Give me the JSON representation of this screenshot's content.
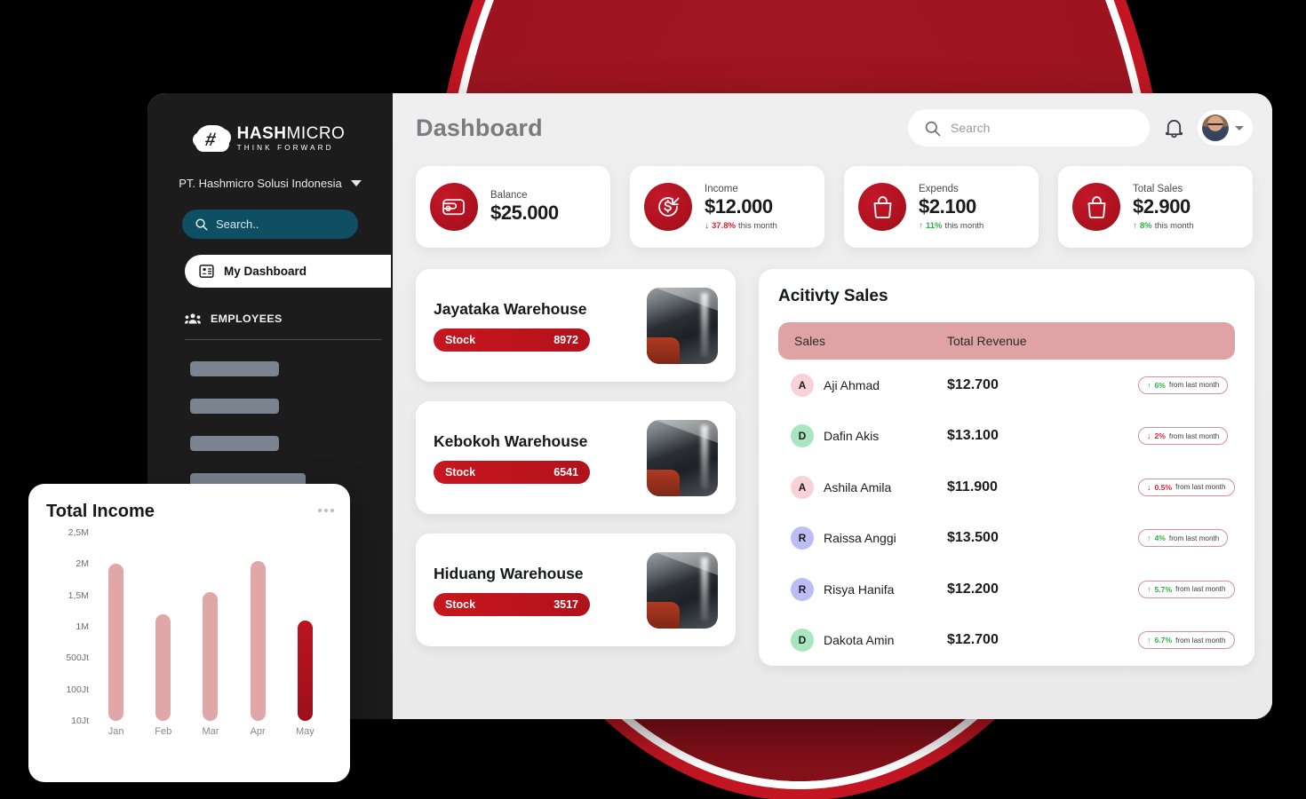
{
  "background": {
    "accent_red": "#a01620",
    "ring_white": "#ffffff",
    "page_bg": "#000000"
  },
  "sidebar": {
    "logo": {
      "name_bold": "HASH",
      "name_thin": "MICRO",
      "tagline": "THINK FORWARD",
      "icon": "hashmicro-cloud-logo"
    },
    "company": "PT. Hashmicro Solusi Indonesia",
    "search_placeholder": "Search..",
    "active_item": {
      "label": "My Dashboard",
      "icon": "dashboard-icon"
    },
    "section": {
      "label": "EMPLOYEES",
      "icon": "people-icon"
    },
    "skeleton_items": 4
  },
  "header": {
    "title": "Dashboard",
    "search_placeholder": "Search",
    "search_value": "",
    "notification_icon": "bell-icon",
    "avatar": "user-avatar",
    "chevron": "chevron-down-icon"
  },
  "stats": [
    {
      "label": "Balance",
      "value": "$25.000",
      "icon": "wallet-icon",
      "delta": null,
      "delta_dir": null,
      "delta_suffix": null
    },
    {
      "label": "Income",
      "value": "$12.000",
      "icon": "income-coin-icon",
      "delta": "37.8%",
      "delta_dir": "down",
      "delta_suffix": "this month"
    },
    {
      "label": "Expends",
      "value": "$2.100",
      "icon": "bag-icon",
      "delta": "11%",
      "delta_dir": "up",
      "delta_suffix": "this month"
    },
    {
      "label": "Total Sales",
      "value": "$2.900",
      "icon": "bag-icon",
      "delta": "8%",
      "delta_dir": "up",
      "delta_suffix": "this month"
    }
  ],
  "warehouses": [
    {
      "name": "Jayataka Warehouse",
      "stock_label": "Stock",
      "stock_value": "8972",
      "thumb": "warehouse-photo"
    },
    {
      "name": "Kebokoh Warehouse",
      "stock_label": "Stock",
      "stock_value": "6541",
      "thumb": "warehouse-photo"
    },
    {
      "name": "Hiduang Warehouse",
      "stock_label": "Stock",
      "stock_value": "3517",
      "thumb": "warehouse-photo"
    }
  ],
  "sales": {
    "title": "Acitivty Sales",
    "columns": {
      "name": "Sales",
      "revenue": "Total Revenue"
    },
    "badge_suffix": "from last month",
    "rows": [
      {
        "initial": "A",
        "avatar_color": "#f8d2d6",
        "name": "Aji Ahmad",
        "revenue": "$12.700",
        "delta": "6%",
        "dir": "up"
      },
      {
        "initial": "D",
        "avatar_color": "#a8e6c0",
        "name": "Dafin Akis",
        "revenue": "$13.100",
        "delta": "2%",
        "dir": "down"
      },
      {
        "initial": "A",
        "avatar_color": "#f8d2d6",
        "name": "Ashila Amila",
        "revenue": "$11.900",
        "delta": "0.5%",
        "dir": "down"
      },
      {
        "initial": "R",
        "avatar_color": "#bcbdf4",
        "name": "Raissa Anggi",
        "revenue": "$13.500",
        "delta": "4%",
        "dir": "up"
      },
      {
        "initial": "R",
        "avatar_color": "#bcbdf4",
        "name": "Risya Hanifa",
        "revenue": "$12.200",
        "delta": "5.7%",
        "dir": "up"
      },
      {
        "initial": "D",
        "avatar_color": "#a8e6c0",
        "name": "Dakota Amin",
        "revenue": "$12.700",
        "delta": "6.7%",
        "dir": "up"
      }
    ]
  },
  "income_card": {
    "title": "Total Income",
    "menu_icon": "more-dots-icon"
  },
  "chart_data": {
    "type": "bar",
    "title": "Total Income",
    "categories": [
      "Jan",
      "Feb",
      "Mar",
      "Apr",
      "May"
    ],
    "values": [
      2000000,
      1200000,
      1550000,
      2050000,
      1100000
    ],
    "value_labels": [
      "2M",
      "1,2M",
      "1,55M",
      "2,05M",
      "1,1M"
    ],
    "ytick_labels": [
      "2,5M",
      "2M",
      "1,5M",
      "1M",
      "500Jt",
      "100Jt",
      "10Jt"
    ],
    "ytick_positions": [
      2500000,
      2000000,
      1500000,
      1000000,
      500000,
      100000,
      10000
    ],
    "ylim": [
      0,
      2500000
    ],
    "xlabel": "",
    "ylabel": "",
    "grid": false,
    "legend": false,
    "bar_color": "#dfa7a8",
    "highlight_color": "#ba1420",
    "highlighted_category": "May"
  }
}
